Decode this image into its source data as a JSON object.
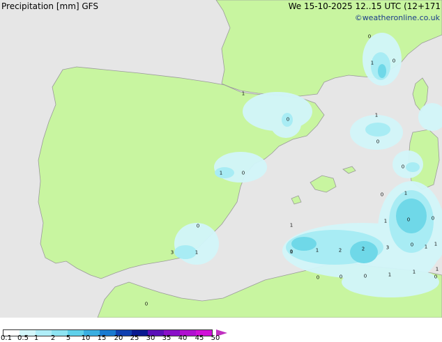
{
  "header": {
    "title": "Precipitation [mm] GFS",
    "valid_time": "We 15-10-2025 12..15 UTC (12+171",
    "copyright": "©weatheronline.co.uk"
  },
  "colors": {
    "sea": "#e6e6e6",
    "land": "#c8f5a0",
    "coast": "#9a9a9a",
    "precip_light": "#d2f6fa",
    "precip_mid": "#a8ecf4",
    "precip_heavy": "#6fd8e8"
  },
  "legend": {
    "ticks": [
      "0.1",
      "0.5",
      "1",
      "2",
      "5",
      "10",
      "15",
      "20",
      "25",
      "30",
      "35",
      "40",
      "45",
      "50"
    ],
    "colors": [
      "#ffffff",
      "#d2f6fa",
      "#b0eef8",
      "#8ee4f2",
      "#5fd0ea",
      "#3aaee0",
      "#1a7ad0",
      "#1040b0",
      "#0a1a90",
      "#5a10b8",
      "#8a10c8",
      "#b010d0",
      "#d010d8"
    ]
  },
  "contour_labels": [
    "0",
    "1",
    "0",
    "1",
    "0",
    "1",
    "0",
    "0",
    "1",
    "0",
    "0",
    "1",
    "0",
    "1",
    "0",
    "0",
    "1",
    "3",
    "1",
    "0",
    "1",
    "2",
    "2",
    "3",
    "0",
    "1",
    "1",
    "0",
    "0",
    "0",
    "1",
    "1",
    "0",
    "1",
    "1",
    "0"
  ]
}
